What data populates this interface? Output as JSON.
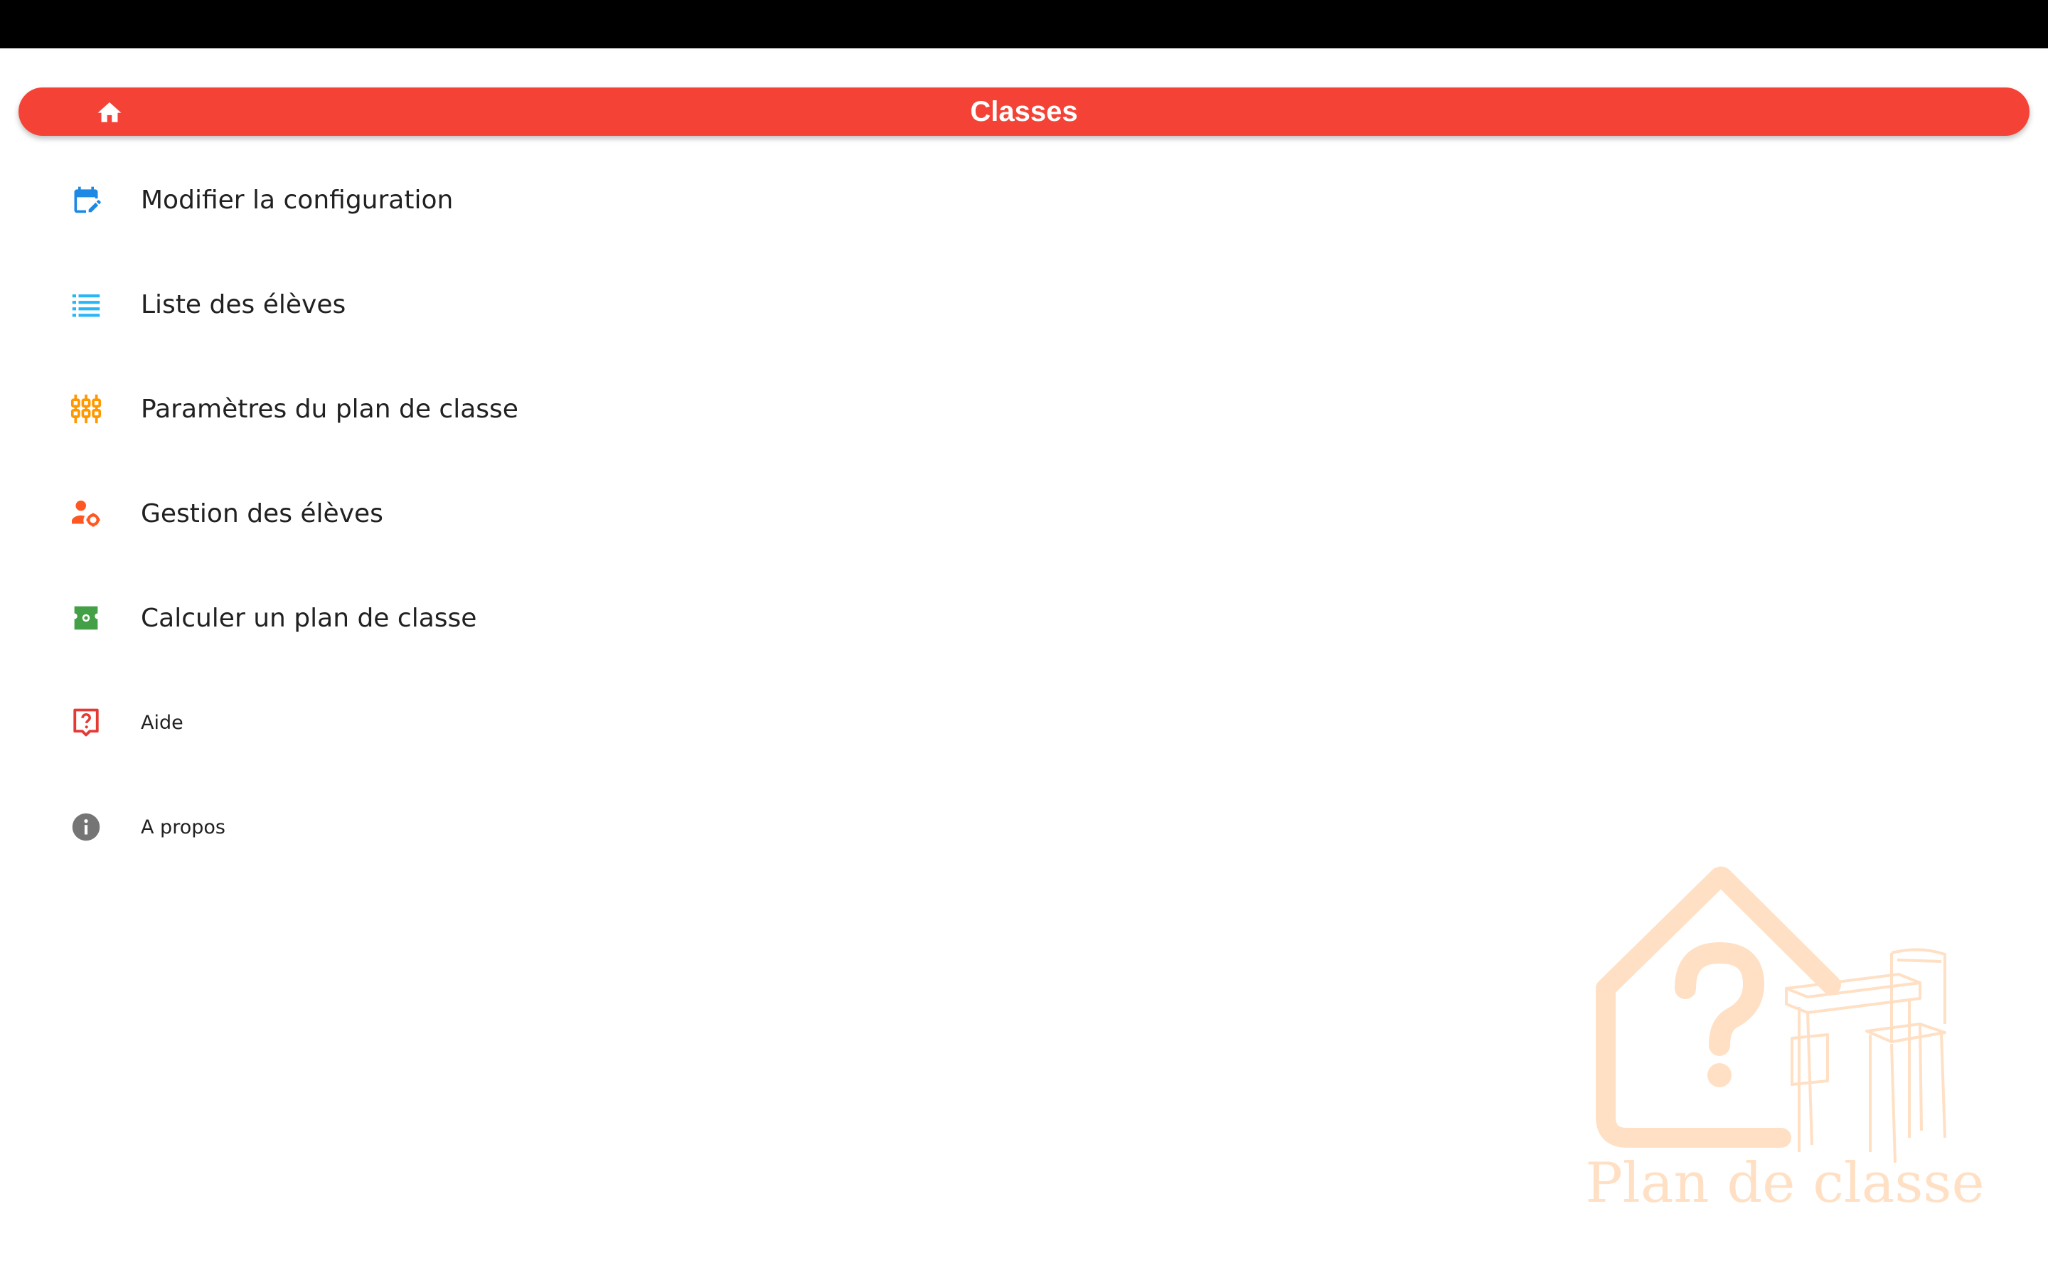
{
  "app_bar": {
    "title": "Classes",
    "home_icon": "home-icon",
    "color": "#f44336"
  },
  "menu": {
    "items": [
      {
        "label": "Modifier la configuration",
        "icon": "calendar-edit-icon",
        "color": "#1e88e5"
      },
      {
        "label": "Liste des élèves",
        "icon": "list-icon",
        "color": "#29b6f6"
      },
      {
        "label": "Paramètres du plan de classe",
        "icon": "tune-sliders-icon",
        "color": "#ff9800"
      },
      {
        "label": "Gestion des élèves",
        "icon": "manage-accounts-icon",
        "color": "#ff5722"
      },
      {
        "label": "Calculer un plan de classe",
        "icon": "calculate-ticket-icon",
        "color": "#43a047"
      },
      {
        "label": "Aide",
        "icon": "help-icon",
        "color": "#e53935"
      },
      {
        "label": "A propos",
        "icon": "info-icon",
        "color": "#757575"
      }
    ]
  },
  "watermark": {
    "text": "Plan de classe",
    "color": "#ffe0c4"
  }
}
